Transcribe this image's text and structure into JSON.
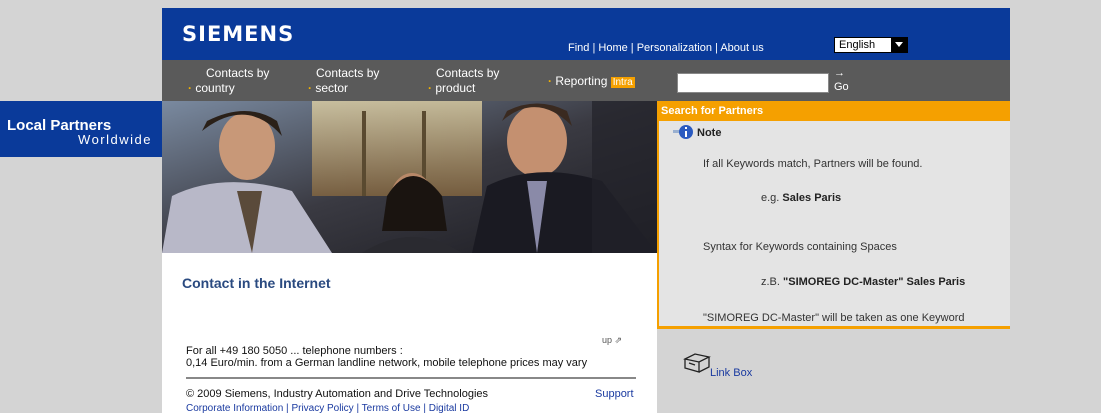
{
  "header": {
    "logo": "SIEMENS",
    "links": [
      "Find",
      "Home",
      "Personalization",
      "About us"
    ],
    "language": "English"
  },
  "nav": {
    "items": [
      {
        "line1": "Contacts by",
        "line2": "country"
      },
      {
        "line1": "Contacts by",
        "line2": "sector"
      },
      {
        "line1": "Contacts by",
        "line2": "product"
      }
    ],
    "reporting": "Reporting",
    "intra": "Intra",
    "search_value": "",
    "go_arrow": "→",
    "go_label": "Go"
  },
  "left": {
    "title": "Local Partners",
    "subtitle": "Worldwide"
  },
  "main": {
    "heading": "Contact in the Internet",
    "up": "up",
    "tel_line1": "For all +49 180 5050 ... telephone numbers :",
    "tel_line2": "0,14 Euro/min. from a German landline network, mobile telephone prices may vary",
    "copyright": "© 2009 Siemens, Industry Automation and Drive Technologies",
    "support": "Support",
    "footer_links": [
      "Corporate Information",
      "Privacy Policy",
      "Terms of Use",
      "Digital ID"
    ]
  },
  "search_panel": {
    "title": "Search for Partners",
    "note": "Note",
    "line1": "If all Keywords match, Partners will be found.",
    "example_prefix": "e.g.",
    "example_value": "Sales Paris",
    "line3": "Syntax for Keywords containing Spaces",
    "example2_prefix": "z.B.",
    "example2_value": "\"SIMOREG DC-Master\" Sales Paris",
    "line5": "\"SIMOREG DC-Master\" will be taken as one Keyword"
  },
  "linkbox": {
    "label": "Link Box"
  },
  "colors": {
    "siemens_blue": "#0a3a9a",
    "nav_grey": "#5a5a5a",
    "orange": "#f5a000",
    "link_blue": "#1a3aa0"
  }
}
